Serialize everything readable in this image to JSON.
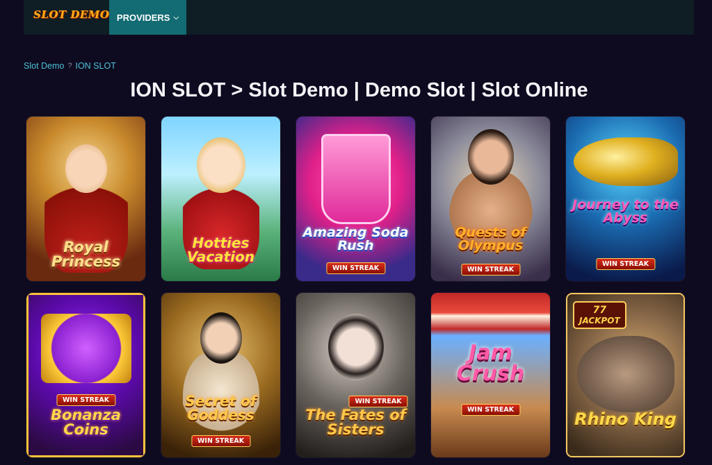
{
  "header": {
    "logo_text": "SLOT DEMO",
    "providers_label": "PROVIDERS",
    "providers_chevron": "⌵"
  },
  "breadcrumb": {
    "home": "Slot Demo",
    "separator": "?",
    "current": "ION SLOT"
  },
  "page_title": "ION SLOT > Slot Demo | Demo Slot | Slot Online",
  "games": [
    {
      "title": "Royal Princess",
      "badge": "",
      "art": "princess-art"
    },
    {
      "title": "Hotties Vacation",
      "badge": "",
      "art": "vacation-art"
    },
    {
      "title": "Amazing Soda Rush",
      "badge": "WIN STREAK",
      "art": "soda-art"
    },
    {
      "title": "Quests of Olympus",
      "badge": "WIN STREAK",
      "art": "olympus-art"
    },
    {
      "title": "Journey to the Abyss",
      "badge": "WIN STREAK",
      "art": "whale-art"
    },
    {
      "title": "Bonanza Coins",
      "badge": "WIN STREAK",
      "art": "seventy-seven-art"
    },
    {
      "title": "Secret of Goddess",
      "badge": "WIN STREAK",
      "art": "goddess-art"
    },
    {
      "title": "The Fates of Sisters",
      "badge": "WIN STREAK",
      "art": "veiled-sister-art"
    },
    {
      "title": "Jam Crush",
      "badge": "WIN STREAK",
      "art": "jam-stall-art"
    },
    {
      "title": "Rhino King",
      "badge": "",
      "art": "rhino-art",
      "jackpot": "JACKPOT",
      "jackpot_number": "77"
    }
  ],
  "colors": {
    "background": "#0e0a1f",
    "topbar": "#0f1d24",
    "providers_button": "#136b73",
    "breadcrumb_link": "#4fc2d8"
  }
}
